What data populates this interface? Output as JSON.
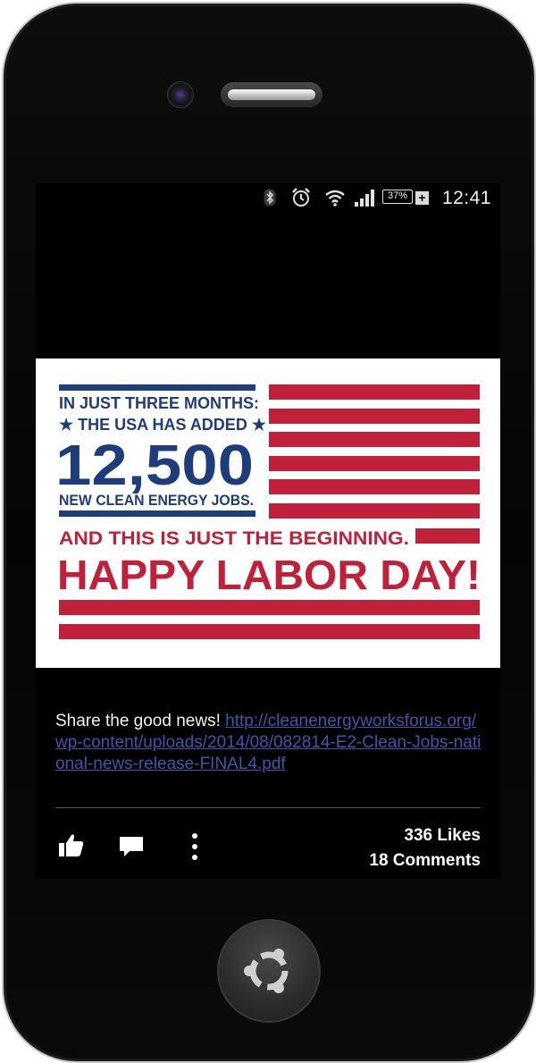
{
  "status_bar": {
    "icons": [
      "bluetooth-icon",
      "alarm-icon",
      "wifi-icon",
      "signal-icon",
      "battery-icon"
    ],
    "battery_level": "37%",
    "battery_plus": "+",
    "time": "12:41"
  },
  "post": {
    "image": {
      "line1": "IN JUST THREE MONTHS:",
      "line2": "★ THE USA HAS ADDED ★",
      "number": "12,500",
      "line3": "NEW CLEAN ENERGY JOBS.",
      "line4": "AND THIS IS JUST THE BEGINNING.",
      "line5": "HAPPY LABOR DAY!",
      "colors": {
        "blue": "#1f3d7a",
        "red": "#c0203a",
        "white": "#ffffff"
      }
    },
    "text_prefix": "Share the good news! ",
    "link_text": "http://cleanenergyworksforus.org/wp-content/uploads/2014/08/082814-E2-Clean-Jobs-national-news-release-FINAL4.pdf",
    "likes": "336 Likes",
    "comments": "18 Comments"
  },
  "actions": [
    "like-icon",
    "comment-icon",
    "more-icon"
  ],
  "hardware": {
    "home_button_icon": "ubuntu-logo-icon"
  }
}
